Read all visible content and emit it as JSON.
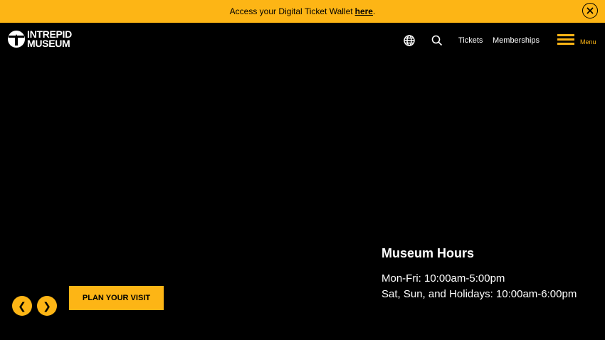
{
  "colors": {
    "accent": "#FDB515",
    "background": "#000000",
    "text": "#FFFFFF"
  },
  "banner": {
    "text": "Access your Digital Ticket Wallet",
    "link_label": "here",
    "suffix": ".",
    "close_icon": "close-icon"
  },
  "header": {
    "logo": {
      "line1": "INTREPID",
      "line2": "MUSEUM",
      "icon": "intrepid-logo-icon"
    },
    "language_icon": "globe-icon",
    "search_icon": "search-icon",
    "tickets_label": "Tickets",
    "memberships_label": "Memberships",
    "menu_label": "Menu",
    "menu_icon": "hamburger-icon"
  },
  "hero": {
    "hours_title": "Museum Hours",
    "hours": [
      "Mon-Fri: 10:00am-5:00pm",
      "Sat, Sun, and Holidays: 10:00am-6:00pm"
    ],
    "cta_label": "PLAN YOUR VISIT",
    "prev_label": "❮",
    "next_label": "❯"
  }
}
